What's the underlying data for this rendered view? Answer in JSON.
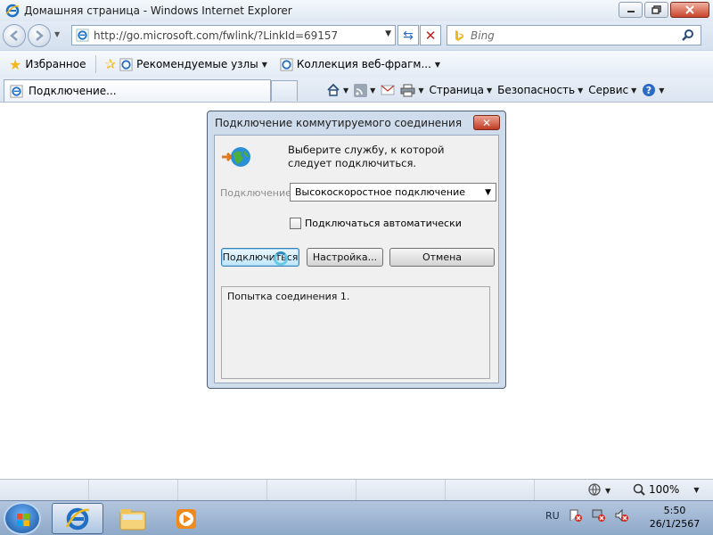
{
  "window": {
    "title": "Домашняя страница - Windows Internet Explorer"
  },
  "address_bar": {
    "url": "http://go.microsoft.com/fwlink/?LinkId=69157",
    "search_placeholder": "Bing"
  },
  "favorites_bar": {
    "favorites_label": "Избранное",
    "suggested_sites_label": "Рекомендуемые узлы",
    "web_slice_gallery_label": "Коллекция веб-фрагм..."
  },
  "tabs": [
    {
      "label": "Подключение..."
    }
  ],
  "command_bar": {
    "page_label": "Страница",
    "safety_label": "Безопасность",
    "tools_label": "Сервис"
  },
  "dialog": {
    "title": "Подключение коммутируемого соединения",
    "prompt": "Выберите службу, к которой следует подключиться.",
    "connection_label": "Подключение:",
    "connection_value": "Высокоскоростное подключение",
    "auto_connect_label": "Подключаться автоматически",
    "auto_connect_checked": false,
    "connect_button": "Подключиться",
    "settings_button": "Настройка...",
    "cancel_button": "Отмена",
    "status_text": "Попытка соединения 1."
  },
  "status_bar": {
    "zoom": "100%"
  },
  "taskbar": {
    "language": "RU",
    "time": "5:50",
    "date": "26/1/2567"
  },
  "colors": {
    "dialog_frame": "#cfdcec",
    "ie_blue": "#1f6fc5",
    "taskbar": "#8ea8c8"
  }
}
